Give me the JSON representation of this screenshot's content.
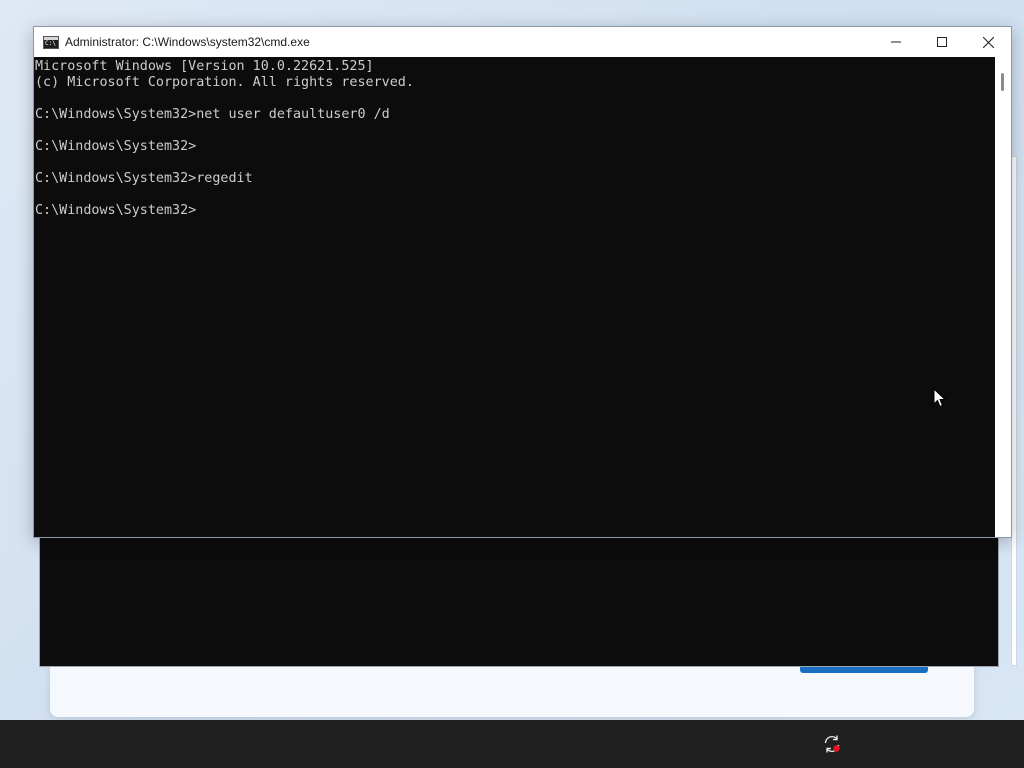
{
  "window": {
    "title": "Administrator: C:\\Windows\\system32\\cmd.exe",
    "icon": "cmd-icon",
    "controls": {
      "minimize": "minimize-icon",
      "maximize": "maximize-icon",
      "close": "close-icon"
    }
  },
  "console": {
    "lines": [
      "Microsoft Windows [Version 10.0.22621.525]",
      "(c) Microsoft Corporation. All rights reserved.",
      "",
      "C:\\Windows\\System32>net user defaultuser0 /d",
      "",
      "C:\\Windows\\System32>",
      "",
      "C:\\Windows\\System32>regedit",
      "",
      "C:\\Windows\\System32>"
    ],
    "text_color": "#cccccc",
    "background_color": "#0c0c0c"
  },
  "taskbar": {
    "tray_icon": "sync-alert-icon",
    "badge_color": "#e81123"
  },
  "colors": {
    "accent": "#1a6fc4",
    "taskbar": "#202020"
  }
}
